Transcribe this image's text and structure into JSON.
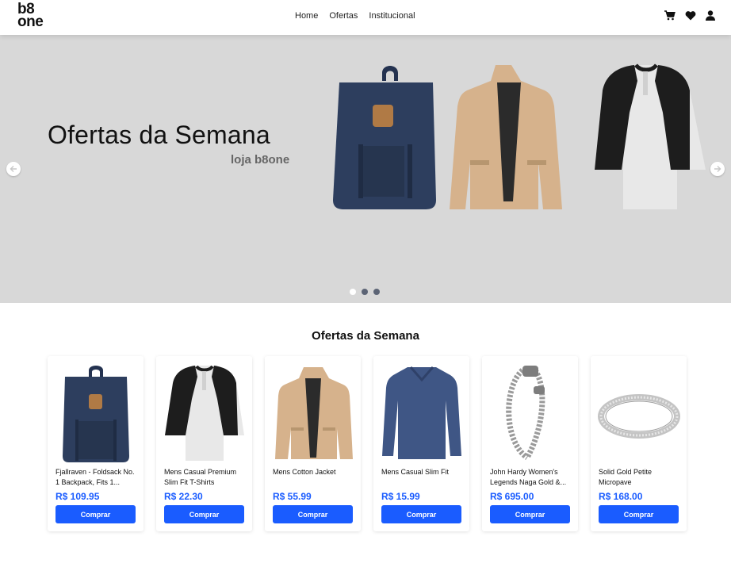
{
  "logo": {
    "line1": "b8",
    "line2": "one"
  },
  "nav": {
    "items": [
      "Home",
      "Ofertas",
      "Institucional"
    ]
  },
  "header_icons": [
    "cart-icon",
    "heart-icon",
    "user-icon"
  ],
  "hero": {
    "title": "Ofertas da Semana",
    "subtitle": "loja b8one",
    "slides_total": 3,
    "active_slide": 1
  },
  "section": {
    "title": "Ofertas da Semana"
  },
  "products": [
    {
      "name": "Fjallraven - Foldsack No. 1 Backpack, Fits 1...",
      "price": "R$ 109.95",
      "button": "Comprar"
    },
    {
      "name": "Mens Casual Premium Slim Fit T-Shirts",
      "price": "R$ 22.30",
      "button": "Comprar"
    },
    {
      "name": "Mens Cotton Jacket",
      "price": "R$ 55.99",
      "button": "Comprar"
    },
    {
      "name": "Mens Casual Slim Fit",
      "price": "R$ 15.99",
      "button": "Comprar"
    },
    {
      "name": "John Hardy Women's Legends Naga Gold &...",
      "price": "R$ 695.00",
      "button": "Comprar"
    },
    {
      "name": "Solid Gold Petite Micropave",
      "price": "R$ 168.00",
      "button": "Comprar"
    }
  ],
  "colors": {
    "accent": "#1a5cff",
    "hero_bg": "#d8d8d8"
  }
}
